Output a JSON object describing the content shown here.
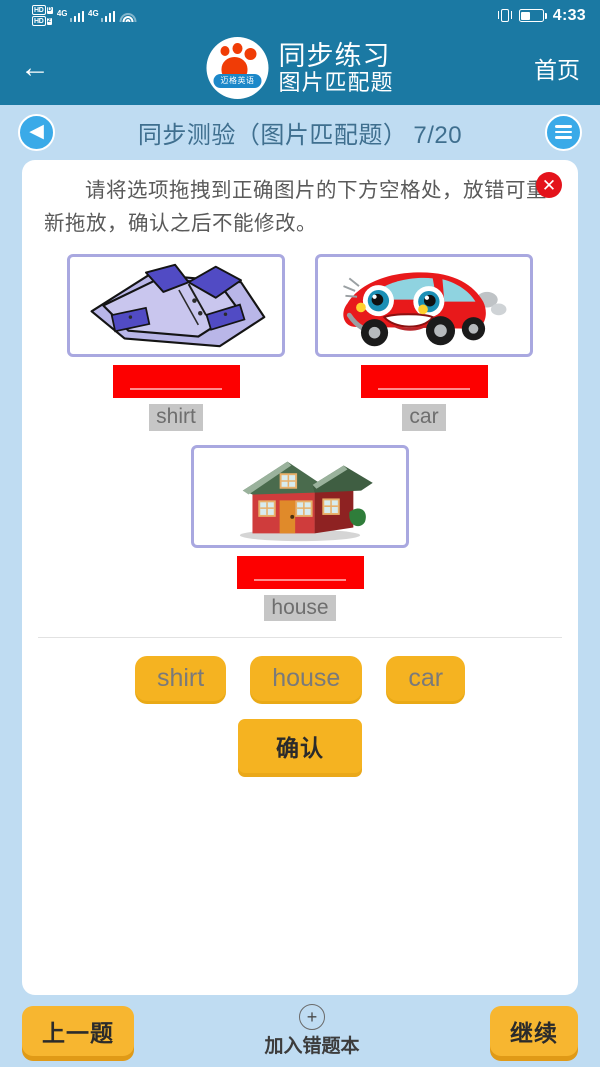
{
  "status_bar": {
    "hd_badge_1": "HD",
    "hd_badge_2": "HD",
    "sim1_label": "D",
    "sim2_label": "2",
    "network_1": "4G",
    "network_2": "4G",
    "wifi_icon": "wifi-icon",
    "vibrate_icon": "vibrate-icon",
    "battery_icon": "battery-icon",
    "time": "4:33"
  },
  "header": {
    "back_icon": "back-arrow-icon",
    "logo_banner_text": "迈格英语",
    "title": "同步练习",
    "subtitle": "图片匹配题",
    "home_label": "首页"
  },
  "subheader": {
    "back_icon": "circle-back-arrow-icon",
    "title": "同步测验（图片匹配题）",
    "counter": "7/20",
    "menu_icon": "hamburger-menu-icon"
  },
  "card": {
    "close_icon": "close-x-icon",
    "instruction": "请将选项拖拽到正确图片的下方空格处，放错可重新拖放，确认之后不能修改。",
    "items": [
      {
        "image": "shirt-image",
        "answer_label": "shirt",
        "slot_value": ""
      },
      {
        "image": "car-image",
        "answer_label": "car",
        "slot_value": ""
      },
      {
        "image": "house-image",
        "answer_label": "house",
        "slot_value": ""
      }
    ],
    "word_bank": [
      "shirt",
      "house",
      "car"
    ],
    "confirm_label": "确认"
  },
  "bottom_bar": {
    "prev_label": "上一题",
    "add_wrong_icon": "plus-circle-icon",
    "add_wrong_label": "加入错题本",
    "continue_label": "继续"
  },
  "colors": {
    "header_blue": "#1b79a3",
    "page_blue": "#bfdcf2",
    "accent_orange": "#f5b321",
    "slot_red": "#fd0000",
    "close_red": "#e4131b",
    "label_gray": "#c6c6c6",
    "title_blue": "#3f6f8f"
  }
}
